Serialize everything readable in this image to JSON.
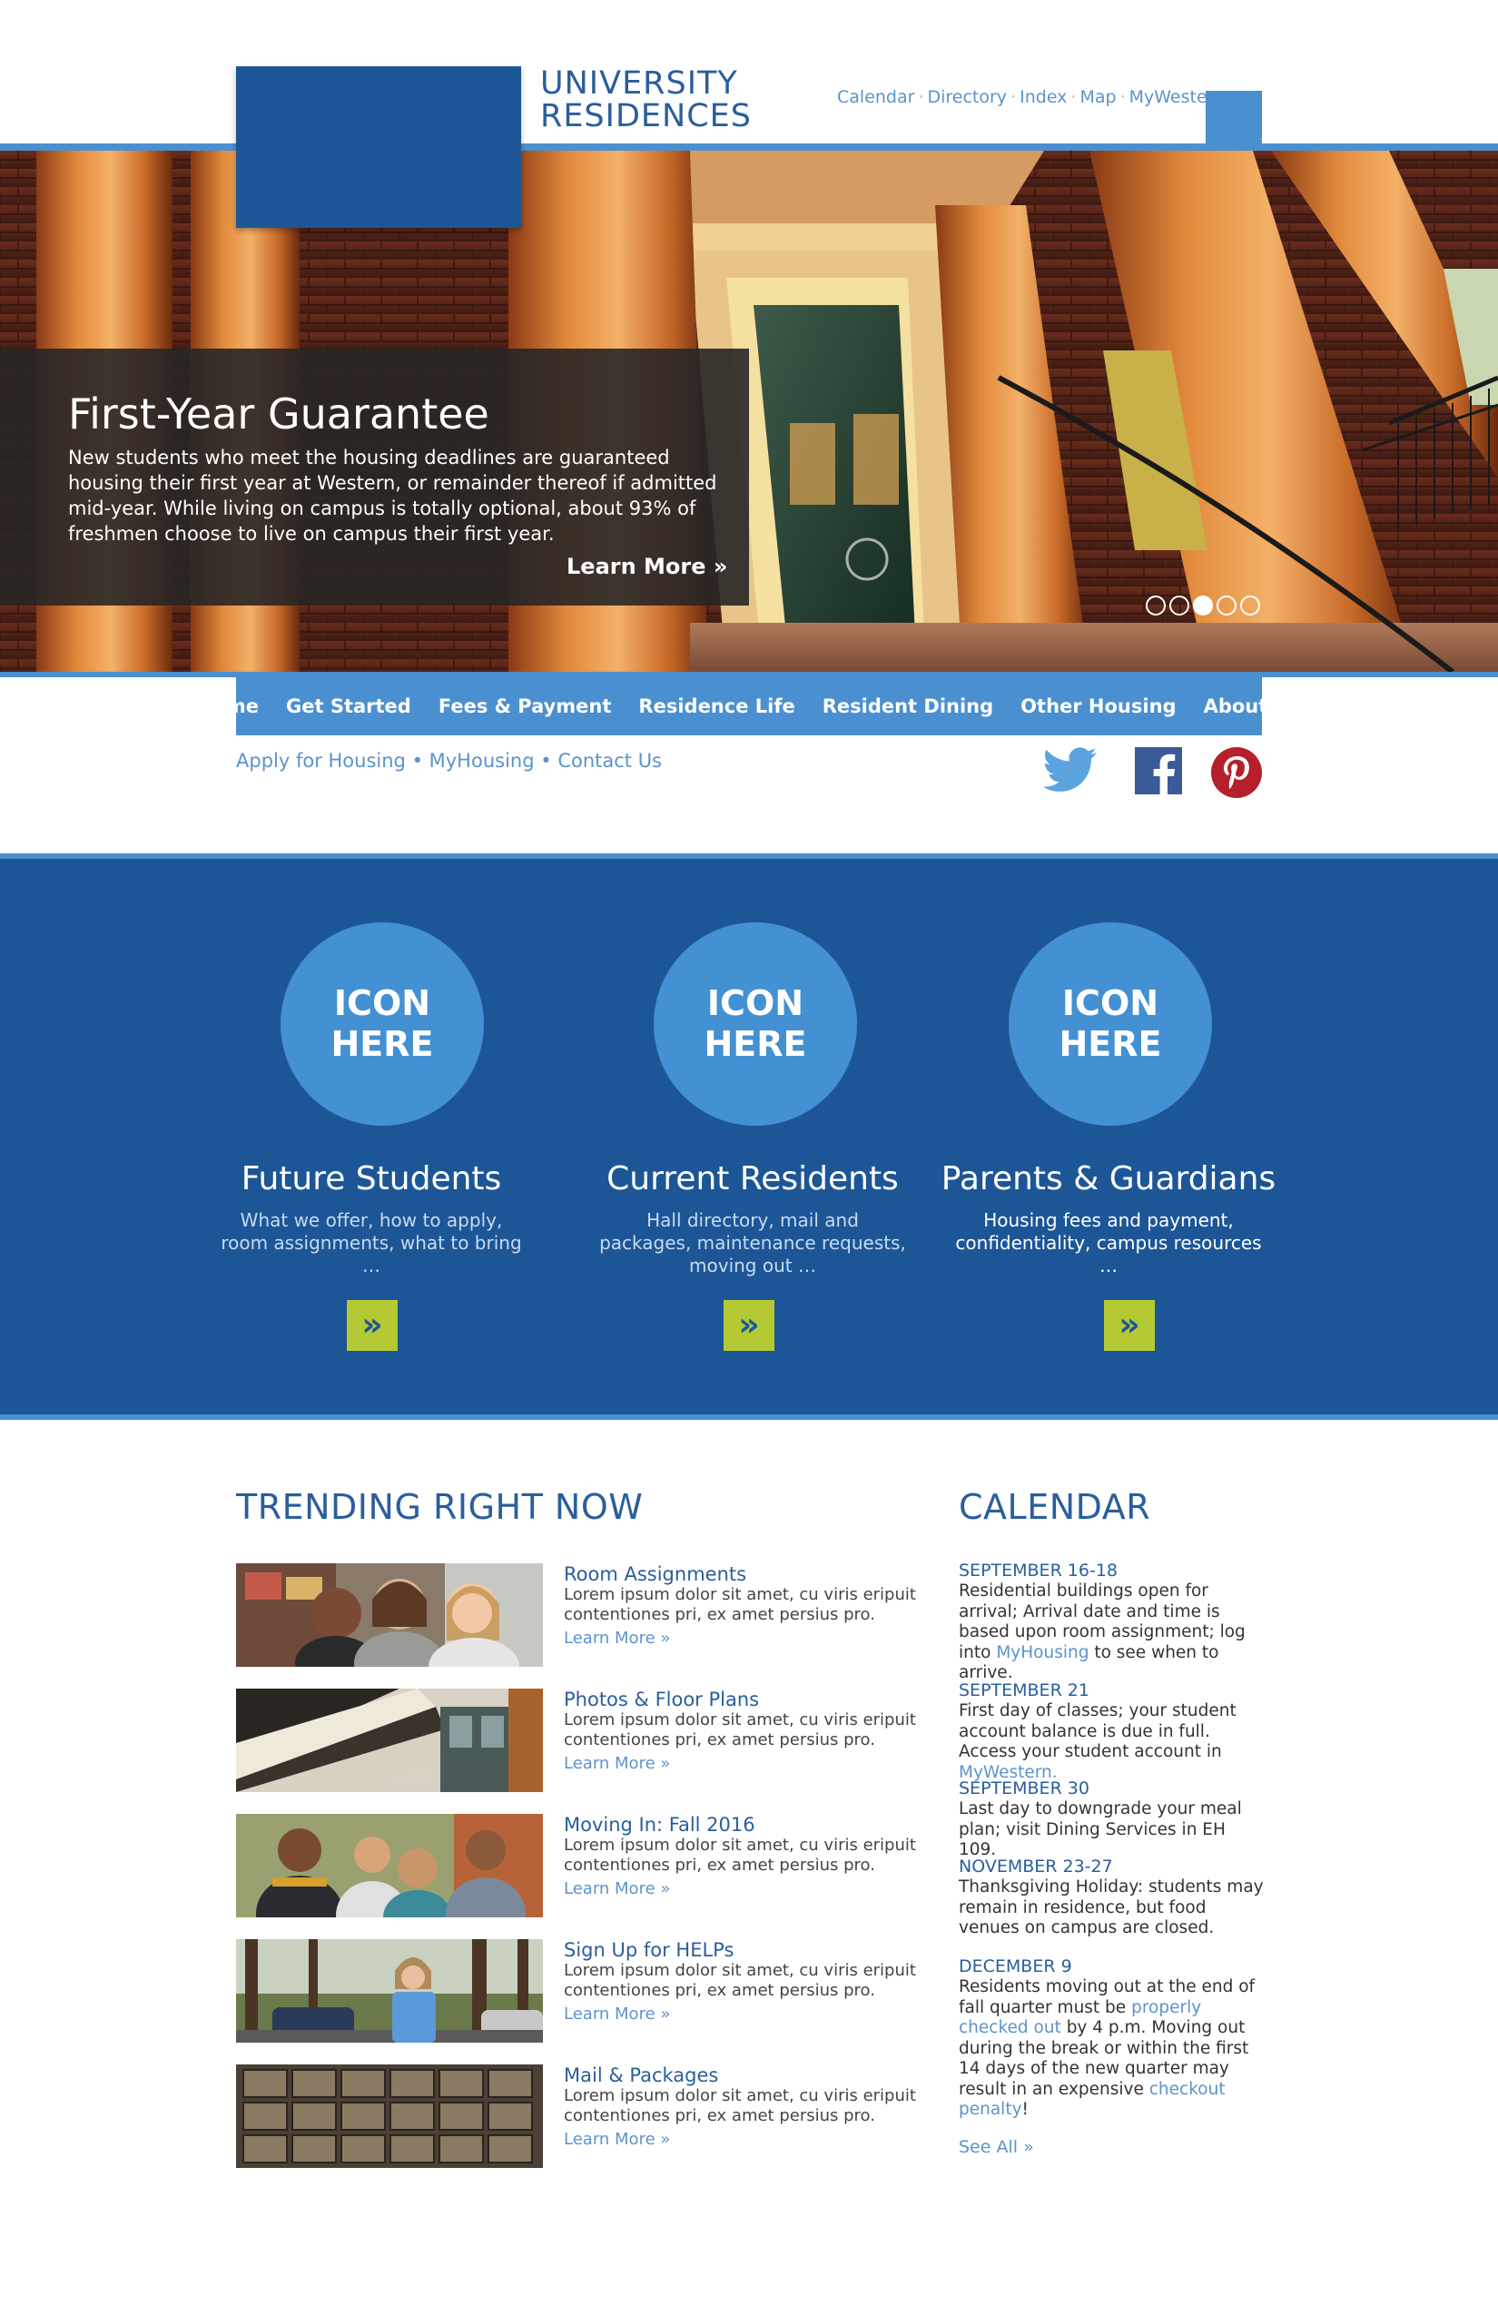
{
  "header": {
    "site_title_line1": "UNIVERSITY",
    "site_title_line2": "RESIDENCES",
    "utility_links": [
      "Calendar",
      "Directory",
      "Index",
      "Map",
      "MyWestern"
    ],
    "logo_color": "#1d5697",
    "search_icon": "search-icon"
  },
  "hero": {
    "title": "First-Year Guarantee",
    "text": "New students who meet the housing deadlines are guaranteed housing their first year at Western, or remainder thereof if admitted mid-year. While living on campus is totally optional, about 93% of freshmen choose to live on campus their first year.",
    "more_label": "Learn More »",
    "slide_count": 5,
    "active_slide": 3
  },
  "main_nav": [
    "Home",
    "Get Started",
    "Fees & Payment",
    "Residence Life",
    "Resident Dining",
    "Other Housing",
    "About Us"
  ],
  "quick_links": [
    "Apply for Housing",
    "MyHousing",
    "Contact Us"
  ],
  "social": [
    "twitter-icon",
    "facebook-icon",
    "pinterest-icon"
  ],
  "audiences": [
    {
      "icon_text": "ICON HERE",
      "title": "Future Students",
      "desc": "What we offer, how to apply, room assignments, what to bring …",
      "btn": "»"
    },
    {
      "icon_text": "ICON HERE",
      "title": "Current Residents",
      "desc": "Hall directory, mail and packages, maintenance requests, moving out …",
      "btn": "»"
    },
    {
      "icon_text": "ICON HERE",
      "title": "Parents & Guardians",
      "desc": "Housing fees and payment, confidentiality, campus resources …",
      "btn": "»"
    }
  ],
  "trending": {
    "heading": "TRENDING RIGHT NOW",
    "items": [
      {
        "title": "Room Assignments",
        "text": "Lorem ipsum dolor sit amet, cu viris eripuit contentiones pri, ex amet persius pro.",
        "more": "Learn More »"
      },
      {
        "title": "Photos & Floor Plans",
        "text": "Lorem ipsum dolor sit amet, cu viris eripuit contentiones pri, ex amet persius pro.",
        "more": "Learn More »"
      },
      {
        "title": "Moving In: Fall 2016",
        "text": "Lorem ipsum dolor sit amet, cu viris eripuit contentiones pri, ex amet persius pro.",
        "more": "Learn More »"
      },
      {
        "title": "Sign Up for HELPs",
        "text": "Lorem ipsum dolor sit amet, cu viris eripuit contentiones pri, ex amet persius pro.",
        "more": "Learn More »"
      },
      {
        "title": "Mail & Packages",
        "text": "Lorem ipsum dolor sit amet, cu viris eripuit contentiones pri, ex amet persius pro.",
        "more": "Learn More »"
      }
    ]
  },
  "calendar": {
    "heading": "CALENDAR",
    "entries": [
      {
        "date": "SEPTEMBER 16-18",
        "before": "Residential buildings open for arrival; Arrival date and time is based upon room assignment; log into ",
        "link": "MyHousing",
        "after": " to see when to arrive."
      },
      {
        "date": "SEPTEMBER 21",
        "before": "First day of classes; your student account balance is due in full. Access your student account in ",
        "link": "MyWestern.",
        "after": ""
      },
      {
        "date": "SEPTEMBER 30",
        "before": "Last day to downgrade your meal plan; visit Dining Services in EH 109.",
        "link": "",
        "after": ""
      },
      {
        "date": "NOVEMBER 23-27",
        "before": "Thanksgiving Holiday: students may remain in residence, but food venues on campus are closed.",
        "link": "",
        "after": ""
      },
      {
        "date": "DECEMBER 9",
        "before": "Residents moving out at the end of fall quarter must be ",
        "link": "properly checked out",
        "after": " by 4 p.m. Moving out during the break or within the first 14 days of the new quarter may result in an expensive ",
        "link2": "checkout penalty",
        "after2": "!"
      }
    ],
    "see_all": "See All »"
  },
  "colors": {
    "dark_blue": "#1d5697",
    "medium_blue": "#4a90d0",
    "link_blue": "#5c93cc",
    "accent_green": "#b5c934"
  }
}
